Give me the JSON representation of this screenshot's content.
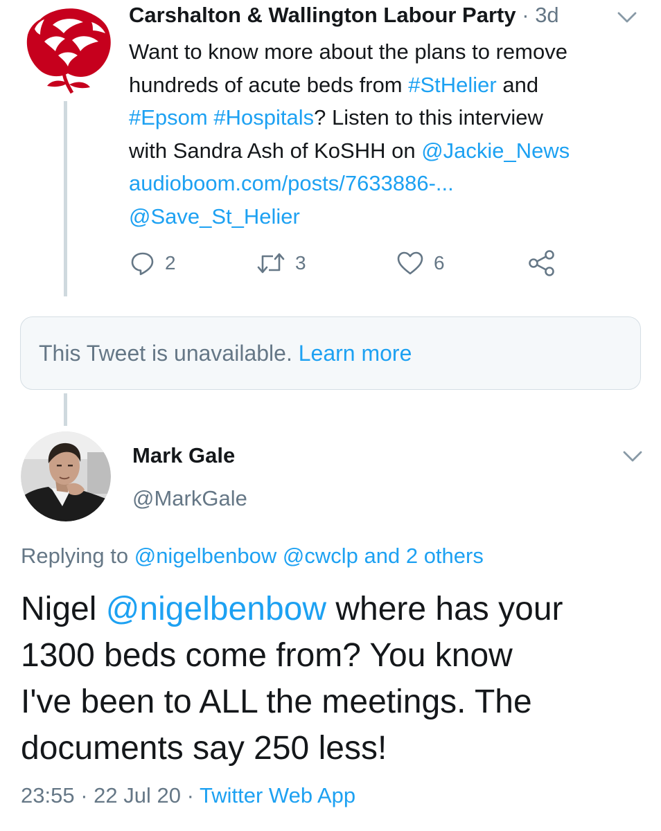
{
  "tweet1": {
    "author_name": "Carshalton & Wallington Labour Party",
    "time_sep": "·",
    "time": "3d",
    "lines": [
      [
        {
          "t": "Want to know more about the plans to remove",
          "link": false
        }
      ],
      [
        {
          "t": "hundreds of acute beds from ",
          "link": false
        },
        {
          "t": "#StHelier",
          "link": true
        },
        {
          "t": " and",
          "link": false
        }
      ],
      [
        {
          "t": "#Epsom",
          "link": true
        },
        {
          "t": " ",
          "link": false
        },
        {
          "t": "#Hospitals",
          "link": true
        },
        {
          "t": "? Listen to this interview",
          "link": false
        }
      ],
      [
        {
          "t": "with Sandra Ash of KoSHH on ",
          "link": false
        },
        {
          "t": "@Jackie_News",
          "link": true
        }
      ],
      [
        {
          "t": "audioboom.com/posts/7633886-...",
          "link": true
        }
      ],
      [
        {
          "t": "@Save_St_Helier",
          "link": true
        }
      ]
    ],
    "actions": {
      "reply_count": "2",
      "retweet_count": "3",
      "like_count": "6"
    }
  },
  "unavailable": {
    "text": "This Tweet is unavailable.",
    "link": "Learn more"
  },
  "tweet2": {
    "author_name": "Mark Gale",
    "handle": "@MarkGale",
    "replying_prefix": "Replying to ",
    "replying_to": [
      {
        "t": "@nigelbenbow",
        "link": true
      },
      {
        "t": " ",
        "link": false
      },
      {
        "t": "@cwclp",
        "link": true
      },
      {
        "t": " and 2 others",
        "link": true
      }
    ],
    "lines": [
      [
        {
          "t": "Nigel ",
          "link": false
        },
        {
          "t": "@nigelbenbow",
          "link": true
        },
        {
          "t": " where has your",
          "link": false
        }
      ],
      [
        {
          "t": "1300 beds come from?  You know",
          "link": false
        }
      ],
      [
        {
          "t": "I've been to ALL the meetings.  The",
          "link": false
        }
      ],
      [
        {
          "t": "documents say 250 less!",
          "link": false
        }
      ]
    ],
    "time": "23:55",
    "sep1": "·",
    "date": "22 Jul 20",
    "sep2": "·",
    "source": "Twitter Web App"
  },
  "colors": {
    "link": "#1da1f2",
    "muted": "#657786",
    "text": "#14171a",
    "card_bg": "#f5f8fa",
    "labour_red": "#c6001d"
  }
}
